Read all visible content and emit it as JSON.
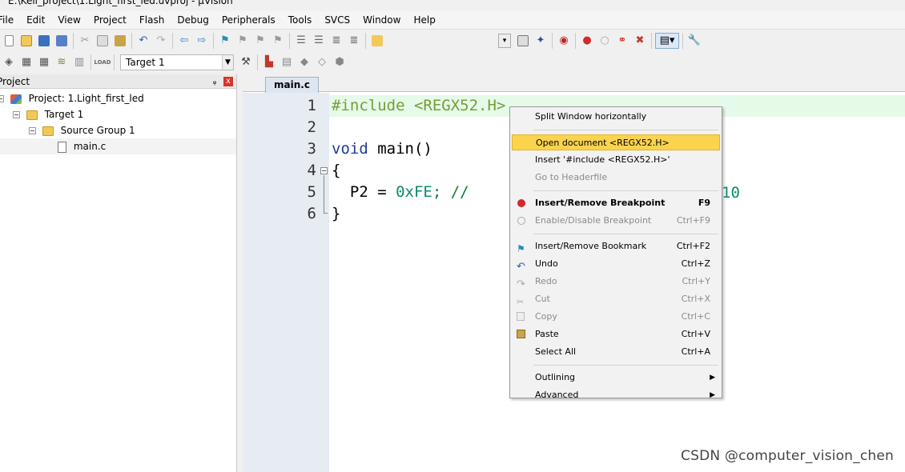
{
  "window": {
    "title": "E:\\Keil_project\\1.Light_first_led.uvproj - µVision"
  },
  "menubar": [
    "File",
    "Edit",
    "View",
    "Project",
    "Flash",
    "Debug",
    "Peripherals",
    "Tools",
    "SVCS",
    "Window",
    "Help"
  ],
  "toolbar2": {
    "target_label": "Target 1"
  },
  "project_pane": {
    "title": "Project",
    "pin": "ᵩ",
    "close": "x",
    "tree": [
      {
        "label": "Project: 1.Light_first_led",
        "level": 0
      },
      {
        "label": "Target 1",
        "level": 1
      },
      {
        "label": "Source Group 1",
        "level": 2
      },
      {
        "label": "main.c",
        "level": 3
      }
    ]
  },
  "editor": {
    "tab": "main.c",
    "line_numbers": [
      "1",
      "2",
      "3",
      "4",
      "5",
      "6"
    ],
    "lines": [
      {
        "parts": [
          {
            "t": "#include <REGX52.H>",
            "c": "pre"
          }
        ]
      },
      {
        "parts": []
      },
      {
        "parts": [
          {
            "t": "void",
            "c": "kw"
          },
          {
            "t": " main()",
            "c": ""
          }
        ]
      },
      {
        "parts": [
          {
            "t": "{",
            "c": ""
          }
        ]
      },
      {
        "parts": [
          {
            "t": "  P2 = ",
            "c": ""
          },
          {
            "t": "0xFE",
            "c": "num"
          },
          {
            "t": "; //",
            "c": "cm"
          }
        ]
      },
      {
        "parts": [
          {
            "t": "}",
            "c": ""
          }
        ]
      }
    ],
    "hidden_tail": "10"
  },
  "context_menu": [
    {
      "label": "Split Window horizontally",
      "shortcut": "",
      "state": "normal"
    },
    {
      "sep": true
    },
    {
      "label": "Open document <REGX52.H>",
      "shortcut": "",
      "state": "hover"
    },
    {
      "label": "Insert '#include <REGX52.H>'",
      "shortcut": "",
      "state": "normal"
    },
    {
      "label": "Go to Headerfile",
      "shortcut": "",
      "state": "disabled"
    },
    {
      "sep": true
    },
    {
      "label": "Insert/Remove Breakpoint",
      "shortcut": "F9",
      "state": "bold",
      "icon": "breakpoint-icon"
    },
    {
      "label": "Enable/Disable Breakpoint",
      "shortcut": "Ctrl+F9",
      "state": "disabled",
      "icon": "breakpoint-disabled-icon"
    },
    {
      "sep": true
    },
    {
      "label": "Insert/Remove Bookmark",
      "shortcut": "Ctrl+F2",
      "state": "normal",
      "icon": "bookmark-icon"
    },
    {
      "label": "Undo",
      "shortcut": "Ctrl+Z",
      "state": "normal",
      "icon": "undo-icon"
    },
    {
      "label": "Redo",
      "shortcut": "Ctrl+Y",
      "state": "disabled",
      "icon": "redo-icon"
    },
    {
      "label": "Cut",
      "shortcut": "Ctrl+X",
      "state": "disabled",
      "icon": "cut-icon"
    },
    {
      "label": "Copy",
      "shortcut": "Ctrl+C",
      "state": "disabled",
      "icon": "copy-icon"
    },
    {
      "label": "Paste",
      "shortcut": "Ctrl+V",
      "state": "normal",
      "icon": "paste-icon"
    },
    {
      "label": "Select All",
      "shortcut": "Ctrl+A",
      "state": "normal"
    },
    {
      "sep": true
    },
    {
      "label": "Outlining",
      "shortcut": "",
      "state": "normal",
      "submenu": true
    },
    {
      "label": "Advanced",
      "shortcut": "",
      "state": "normal",
      "submenu": true
    }
  ],
  "watermark": "CSDN @computer_vision_chen",
  "colors": {
    "accent_hover": "#fcd34d",
    "current_line": "#e5fae8",
    "close_red": "#d9342b"
  }
}
